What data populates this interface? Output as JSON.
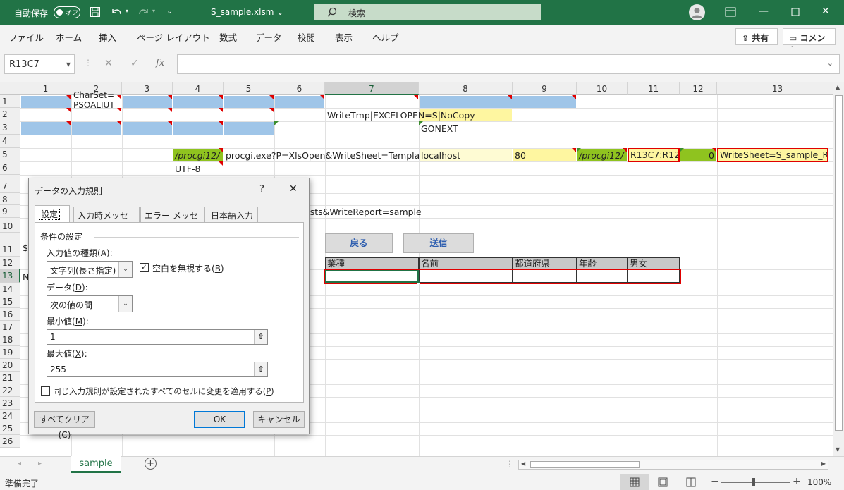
{
  "titlebar": {
    "autosave_label": "自動保存",
    "autosave_state": "オフ",
    "filename": "S_sample.xlsm ⌄",
    "search_placeholder": "検索",
    "bg_color": "#217346"
  },
  "menu": {
    "items": [
      "ファイル",
      "ホーム",
      "挿入",
      "ページ レイアウト",
      "数式",
      "データ",
      "校閲",
      "表示",
      "ヘルプ"
    ],
    "share_label": "共有",
    "comment_label": "コメント"
  },
  "formula_bar": {
    "name_box": "R13C7",
    "fx_label": "fx",
    "formula": ""
  },
  "grid": {
    "column_headers": [
      "1",
      "2",
      "3",
      "4",
      "5",
      "6",
      "7",
      "8",
      "9",
      "10",
      "11",
      "12",
      "13"
    ],
    "row_headers": [
      "1",
      "2",
      "3",
      "4",
      "5",
      "6",
      "7",
      "8",
      "9",
      "10",
      "11",
      "12",
      "13",
      "14",
      "15",
      "16",
      "17",
      "18",
      "19",
      "20",
      "21",
      "22",
      "23",
      "24",
      "25",
      "26"
    ],
    "selected_column": "7",
    "selected_row": "13",
    "cells": {
      "r1c2": "CharSet=",
      "r1c2b": "PSOALIUT",
      "r2c7": "WriteTmp|EXCELOPEN=S|NoCopy",
      "r3c8": "GONEXT",
      "r5c4": "/procgi12/",
      "r5c5": "procgi.exe?P=XlsOpen&WriteSheet=Templat",
      "r5c8": "localhost",
      "r5c9": "80",
      "r5c10": "/procgi12/",
      "r5c11": "R13C7:R12",
      "r5c12": "0",
      "r5c13": "WriteSheet=S_sample_R",
      "r6c4": "UTF-8",
      "r9c6": "ests&WriteReport=sample",
      "r11c1": "$S",
      "r13c1": "N"
    },
    "buttons": {
      "back": "戻る",
      "send": "送信"
    },
    "table_headers": [
      "業種",
      "名前",
      "都道府県",
      "年齢",
      "男女"
    ]
  },
  "dialog": {
    "title": "データの入力規則",
    "help": "?",
    "close": "✕",
    "tabs": [
      "設定",
      "入力時メッセージ",
      "エラー メッセージ",
      "日本語入力"
    ],
    "section_label": "条件の設定",
    "type_label_pre": "入力値の種類(",
    "type_label_key": "A",
    "type_label_post": "):",
    "type_value": "文字列(長さ指定)",
    "ignore_blank_pre": "空白を無視する(",
    "ignore_blank_key": "B",
    "ignore_blank_post": ")",
    "ignore_blank_checked": "✓",
    "data_label_pre": "データ(",
    "data_label_key": "D",
    "data_label_post": "):",
    "data_value": "次の値の間",
    "min_label_pre": "最小値(",
    "min_label_key": "M",
    "min_label_post": "):",
    "min_value": "1",
    "max_label_pre": "最大値(",
    "max_label_key": "X",
    "max_label_post": "):",
    "max_value": "255",
    "apply_all_pre": "同じ入力規則が設定されたすべてのセルに変更を適用する(",
    "apply_all_key": "P",
    "apply_all_post": ")",
    "clear_all_pre": "すべてクリア(",
    "clear_all_key": "C",
    "clear_all_post": ")",
    "ok": "OK",
    "cancel": "キャンセル"
  },
  "sheet_tab": "sample",
  "status": {
    "text": "準備完了",
    "zoom": "100%"
  }
}
